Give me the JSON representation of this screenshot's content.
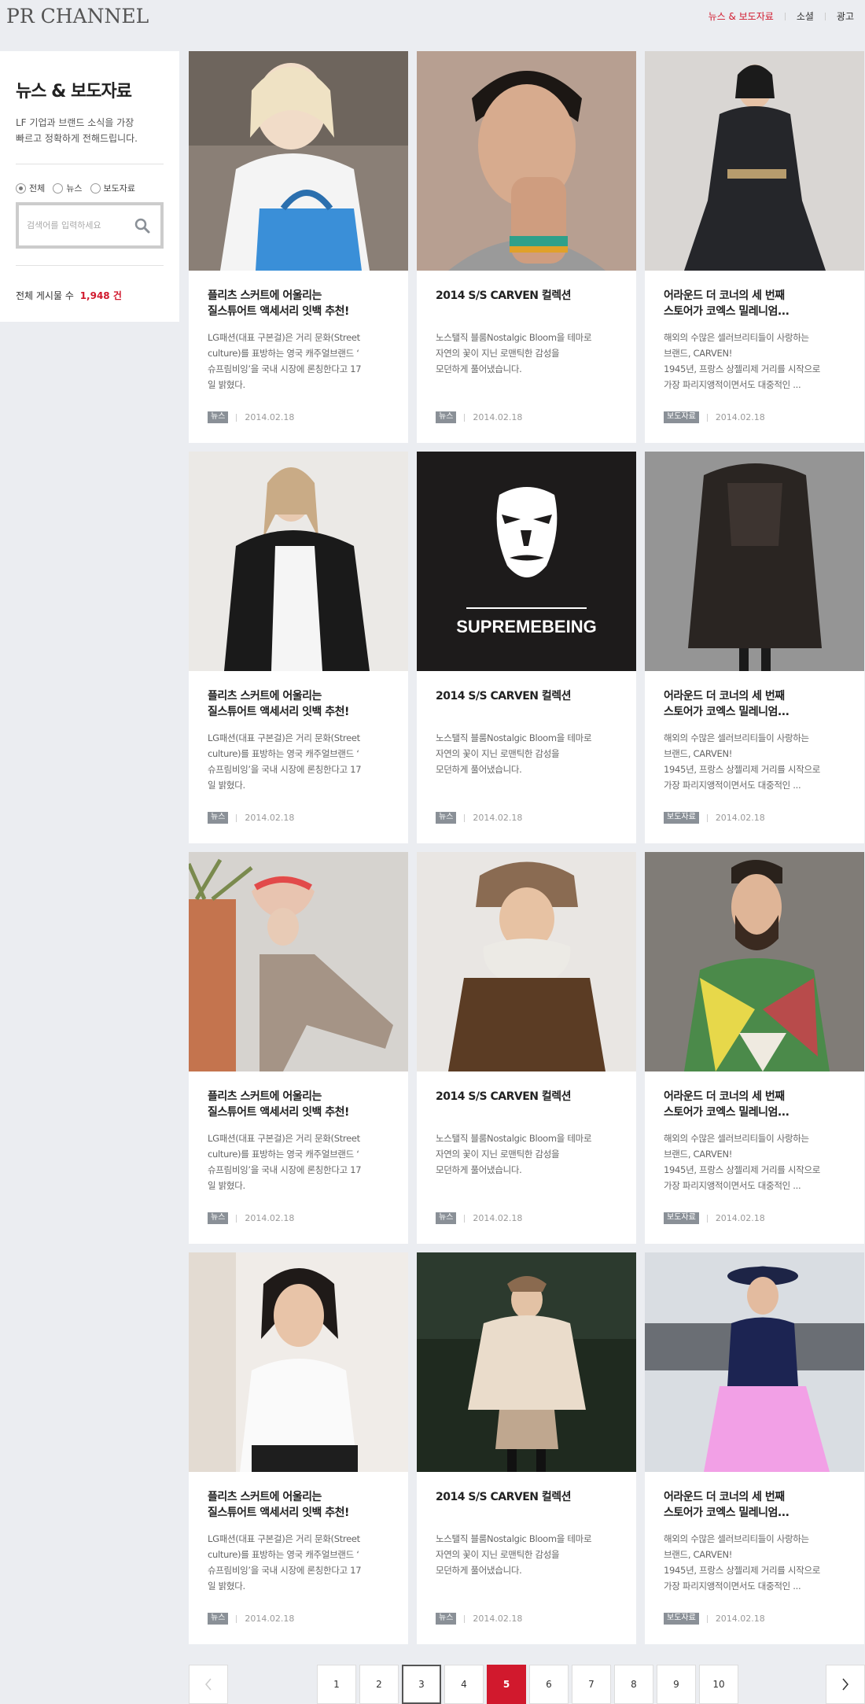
{
  "header": {
    "logo": "PR CHANNEL",
    "nav": [
      {
        "label": "뉴스 & 보도자료",
        "active": true
      },
      {
        "label": "소셜",
        "active": false
      },
      {
        "label": "광고",
        "active": false
      }
    ]
  },
  "sidebar": {
    "title": "뉴스 & 보도자료",
    "desc_line1": "LF 기업과 브랜드 소식을 가장",
    "desc_line2": "빠르고 정확하게 전해드립니다.",
    "filters": [
      {
        "label": "전체",
        "selected": true
      },
      {
        "label": "뉴스",
        "selected": false
      },
      {
        "label": "보도자료",
        "selected": false
      }
    ],
    "search_placeholder": "검색어를 입력하세요",
    "total_label": "전체 게시물 수",
    "total_count": "1,948 건"
  },
  "cards": [
    {
      "title1": "플리츠 스커트에 어울리는",
      "title2": "질스튜어트 액세서리 잇백 추천!",
      "excerpt": [
        "LG패션(대표 구본걸)은 거리 문화(Street",
        "culture)를 표방하는 영국 캐주얼브랜드 ‘",
        "슈프림비잉’을 국내 시장에 론칭한다고 17",
        "일 밝혔다."
      ],
      "tag": "뉴스",
      "date": "2014.02.18",
      "image": "woman-blonde-bob-blue-bag"
    },
    {
      "title1": "2014 S/S CARVEN 컬렉션",
      "title2": "",
      "excerpt": [
        "노스탤직 블룸Nostalgic Bloom을 테마로",
        "자연의 꽃이 지닌 로맨틱한 감성을",
        "모던하게 풀어냈습니다.",
        ""
      ],
      "tag": "뉴스",
      "date": "2014.02.18",
      "image": "man-hand-on-face"
    },
    {
      "title1": "어라운드 더 코너의 세 번째",
      "title2": "스토어가 코엑스 밀레니엄...",
      "excerpt": [
        "해외의 수많은 셀러브리티들이 사랑하는",
        "브랜드, CARVEN!",
        "1945년, 프랑스 상젤리제 거리를 시작으로",
        "가장 파리지앵적이면서도 대중적인 ..."
      ],
      "tag": "보도자료",
      "date": "2014.02.18",
      "image": "woman-dark-dress"
    },
    {
      "title1": "플리츠 스커트에 어울리는",
      "title2": "질스튜어트 액세서리 잇백 추천!",
      "excerpt": [
        "LG패션(대표 구본걸)은 거리 문화(Street",
        "culture)를 표방하는 영국 캐주얼브랜드 ‘",
        "슈프림비잉’을 국내 시장에 론칭한다고 17",
        "일 밝혔다."
      ],
      "tag": "뉴스",
      "date": "2014.02.18",
      "image": "woman-black-coat"
    },
    {
      "title1": "2014 S/S CARVEN 컬렉션",
      "title2": "",
      "excerpt": [
        "노스탤직 블룸Nostalgic Bloom을 테마로",
        "자연의 꽃이 지닌 로맨틱한 감성을",
        "모던하게 풀어냈습니다.",
        ""
      ],
      "tag": "뉴스",
      "date": "2014.02.18",
      "image": "supremebeing-logo",
      "logo_text": "SUPREMEBEING"
    },
    {
      "title1": "어라운드 더 코너의 세 번째",
      "title2": "스토어가 코엑스 밀레니엄...",
      "excerpt": [
        "해외의 수많은 셀러브리티들이 사랑하는",
        "브랜드, CARVEN!",
        "1945년, 프랑스 상젤리제 거리를 시작으로",
        "가장 파리지앵적이면서도 대중적인 ..."
      ],
      "tag": "보도자료",
      "date": "2014.02.18",
      "image": "fur-coat"
    },
    {
      "title1": "플리츠 스커트에 어울리는",
      "title2": "질스튜어트 액세서리 잇백 추천!",
      "excerpt": [
        "LG패션(대표 구본걸)은 거리 문화(Street",
        "culture)를 표방하는 영국 캐주얼브랜드 ‘",
        "슈프림비잉’을 국내 시장에 론칭한다고 17",
        "일 밝혔다."
      ],
      "tag": "뉴스",
      "date": "2014.02.18",
      "image": "woman-turban-seated"
    },
    {
      "title1": "2014 S/S CARVEN 컬렉션",
      "title2": "",
      "excerpt": [
        "노스탤직 블룸Nostalgic Bloom을 테마로",
        "자연의 꽃이 지닌 로맨틱한 감성을",
        "모던하게 풀어냈습니다.",
        ""
      ],
      "tag": "뉴스",
      "date": "2014.02.18",
      "image": "man-fur-hat-scarf"
    },
    {
      "title1": "어라운드 더 코너의 세 번째",
      "title2": "스토어가 코엑스 밀레니엄...",
      "excerpt": [
        "해외의 수많은 셀러브리티들이 사랑하는",
        "브랜드, CARVEN!",
        "1945년, 프랑스 상젤리제 거리를 시작으로",
        "가장 파리지앵적이면서도 대중적인 ..."
      ],
      "tag": "보도자료",
      "date": "2014.02.18",
      "image": "bearded-man-jacket"
    },
    {
      "title1": "플리츠 스커트에 어울리는",
      "title2": "질스튜어트 액세서리 잇백 추천!",
      "excerpt": [
        "LG패션(대표 구본걸)은 거리 문화(Street",
        "culture)를 표방하는 영국 캐주얼브랜드 ‘",
        "슈프림비잉’을 국내 시장에 론칭한다고 17",
        "일 밝혔다."
      ],
      "tag": "뉴스",
      "date": "2014.02.18",
      "image": "woman-white-top"
    },
    {
      "title1": "2014 S/S CARVEN 컬렉션",
      "title2": "",
      "excerpt": [
        "노스탤직 블룸Nostalgic Bloom을 테마로",
        "자연의 꽃이 지닌 로맨틱한 감성을",
        "모던하게 풀어냈습니다.",
        ""
      ],
      "tag": "뉴스",
      "date": "2014.02.18",
      "image": "runway-cape"
    },
    {
      "title1": "어라운드 더 코너의 세 번째",
      "title2": "스토어가 코엑스 밀레니엄...",
      "excerpt": [
        "해외의 수많은 셀러브리티들이 사랑하는",
        "브랜드, CARVEN!",
        "1945년, 프랑스 상젤리제 거리를 시작으로",
        "가장 파리지앵적이면서도 대중적인 ..."
      ],
      "tag": "보도자료",
      "date": "2014.02.18",
      "image": "street-hat-pink-skirt"
    }
  ],
  "pagination": {
    "pages": [
      "1",
      "2",
      "3",
      "4",
      "5",
      "6",
      "7",
      "8",
      "9",
      "10"
    ],
    "current": "5",
    "hover": "3"
  },
  "colors": {
    "accent": "#d1192d",
    "background": "#ebedf1",
    "tag": "#8a9097"
  }
}
